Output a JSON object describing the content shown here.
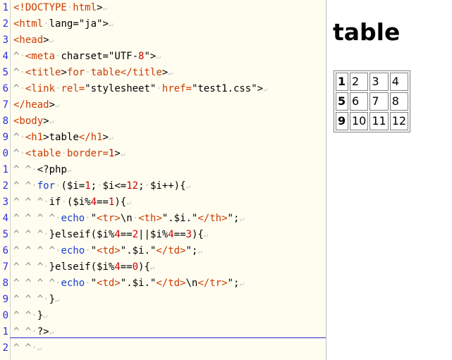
{
  "editor": {
    "line_numbers": [
      "1",
      "2",
      "3",
      "4",
      "5",
      "6",
      "7",
      "8",
      "9",
      "0",
      "1",
      "2",
      "3",
      "4",
      "5",
      "6",
      "7",
      "8",
      "9",
      "0",
      "1",
      "2"
    ],
    "lines": [
      [
        [
          "tag",
          "<!DOCTYPE"
        ],
        [
          "ws",
          "·"
        ],
        [
          "tag",
          "html"
        ],
        [
          "br",
          ">"
        ]
      ],
      [
        [
          "tag",
          "<html"
        ],
        [
          "ws",
          "·"
        ],
        [
          "str",
          "lang=\"ja\""
        ],
        [
          "br",
          ">"
        ]
      ],
      [
        [
          "tag",
          "<head"
        ],
        [
          "br",
          ">"
        ]
      ],
      [
        [
          "indent",
          "^"
        ],
        [
          "ws",
          "·"
        ],
        [
          "tag",
          "<meta"
        ],
        [
          "ws",
          "·"
        ],
        [
          "str",
          "charset=\"UTF-"
        ],
        [
          "num",
          "8"
        ],
        [
          "str",
          "\""
        ],
        [
          "br",
          ">"
        ]
      ],
      [
        [
          "indent",
          "^"
        ],
        [
          "ws",
          "·"
        ],
        [
          "tag",
          "<title"
        ],
        [
          "br",
          ">"
        ],
        [
          "tag",
          "for"
        ],
        [
          "ws",
          "·"
        ],
        [
          "tag",
          "table"
        ],
        [
          "tag",
          "</title"
        ],
        [
          "br",
          ">"
        ]
      ],
      [
        [
          "indent",
          "^"
        ],
        [
          "ws",
          "·"
        ],
        [
          "tag",
          "<link"
        ],
        [
          "ws",
          "·"
        ],
        [
          "tag",
          "rel="
        ],
        [
          "str",
          "\"stylesheet\""
        ],
        [
          "ws",
          "·"
        ],
        [
          "tag",
          "href="
        ],
        [
          "str",
          "\"test1.css\""
        ],
        [
          "br",
          ">"
        ]
      ],
      [
        [
          "tag",
          "</head"
        ],
        [
          "br",
          ">"
        ]
      ],
      [
        [
          "tag",
          "<body"
        ],
        [
          "br",
          ">"
        ]
      ],
      [
        [
          "indent",
          "^"
        ],
        [
          "ws",
          "·"
        ],
        [
          "tag",
          "<h1"
        ],
        [
          "br",
          ">"
        ],
        [
          "op",
          "table"
        ],
        [
          "tag",
          "</h1"
        ],
        [
          "br",
          ">"
        ]
      ],
      [
        [
          "indent",
          "^"
        ],
        [
          "ws",
          "·"
        ],
        [
          "tag",
          "<table"
        ],
        [
          "ws",
          "·"
        ],
        [
          "tag",
          "border="
        ],
        [
          "num",
          "1"
        ],
        [
          "br",
          ">"
        ]
      ],
      [
        [
          "indent",
          "^ ^"
        ],
        [
          "ws",
          "·"
        ],
        [
          "op",
          "<?php"
        ]
      ],
      [
        [
          "indent",
          "^ ^"
        ],
        [
          "ws",
          "·"
        ],
        [
          "kw",
          "for"
        ],
        [
          "ws",
          "·"
        ],
        [
          "op",
          "($i="
        ],
        [
          "num",
          "1"
        ],
        [
          "op",
          ";"
        ],
        [
          "ws",
          "·"
        ],
        [
          "op",
          "$i<="
        ],
        [
          "num",
          "12"
        ],
        [
          "op",
          ";"
        ],
        [
          "ws",
          "·"
        ],
        [
          "op",
          "$i++){"
        ]
      ],
      [
        [
          "indent",
          "^ ^ ^"
        ],
        [
          "ws",
          "·"
        ],
        [
          "op",
          "if"
        ],
        [
          "ws",
          "·"
        ],
        [
          "op",
          "($i%"
        ],
        [
          "num",
          "4"
        ],
        [
          "op",
          "=="
        ],
        [
          "num",
          "1"
        ],
        [
          "op",
          "){"
        ]
      ],
      [
        [
          "indent",
          "^ ^ ^ ^"
        ],
        [
          "ws",
          "·"
        ],
        [
          "kw",
          "echo"
        ],
        [
          "ws",
          "·"
        ],
        [
          "op",
          "\""
        ],
        [
          "tag",
          "<tr>"
        ],
        [
          "op",
          "\\n"
        ],
        [
          "ws",
          "·"
        ],
        [
          "tag",
          "<th>"
        ],
        [
          "op",
          "\".$i.\""
        ],
        [
          "tag",
          "</th>"
        ],
        [
          "op",
          "\";"
        ]
      ],
      [
        [
          "indent",
          "^ ^ ^"
        ],
        [
          "ws",
          "·"
        ],
        [
          "op",
          "}elseif($i%"
        ],
        [
          "num",
          "4"
        ],
        [
          "op",
          "=="
        ],
        [
          "num",
          "2"
        ],
        [
          "op",
          "||$i%"
        ],
        [
          "num",
          "4"
        ],
        [
          "op",
          "=="
        ],
        [
          "num",
          "3"
        ],
        [
          "op",
          "){"
        ]
      ],
      [
        [
          "indent",
          "^ ^ ^ ^"
        ],
        [
          "ws",
          "·"
        ],
        [
          "kw",
          "echo"
        ],
        [
          "ws",
          "·"
        ],
        [
          "op",
          "\""
        ],
        [
          "tag",
          "<td>"
        ],
        [
          "op",
          "\".$i.\""
        ],
        [
          "tag",
          "</td>"
        ],
        [
          "op",
          "\";"
        ]
      ],
      [
        [
          "indent",
          "^ ^ ^"
        ],
        [
          "ws",
          "·"
        ],
        [
          "op",
          "}elseif($i%"
        ],
        [
          "num",
          "4"
        ],
        [
          "op",
          "=="
        ],
        [
          "num",
          "0"
        ],
        [
          "op",
          "){"
        ]
      ],
      [
        [
          "indent",
          "^ ^ ^ ^"
        ],
        [
          "ws",
          "·"
        ],
        [
          "kw",
          "echo"
        ],
        [
          "ws",
          "·"
        ],
        [
          "op",
          "\""
        ],
        [
          "tag",
          "<td>"
        ],
        [
          "op",
          "\".$i.\""
        ],
        [
          "tag",
          "</td>"
        ],
        [
          "op",
          "\\n"
        ],
        [
          "tag",
          "</tr>"
        ],
        [
          "op",
          "\";"
        ]
      ],
      [
        [
          "indent",
          "^ ^ ^"
        ],
        [
          "ws",
          "·"
        ],
        [
          "op",
          "}"
        ]
      ],
      [
        [
          "indent",
          "^ ^"
        ],
        [
          "ws",
          "·"
        ],
        [
          "op",
          "}"
        ]
      ],
      [
        [
          "indent",
          "^ ^"
        ],
        [
          "ws",
          "·"
        ],
        [
          "op",
          "?>"
        ]
      ],
      [
        [
          "indent",
          "^ ^"
        ],
        [
          "ws",
          "·"
        ]
      ]
    ],
    "eol_mark": "↵",
    "colors": {
      "tag": "#cc3b00",
      "keyword": "#1a3fd0",
      "number": "#cc0000",
      "line_number": "#2d2de0",
      "background": "#fefdf0"
    }
  },
  "preview": {
    "heading": "table",
    "table": {
      "rows": [
        {
          "th": "1",
          "td": [
            "2",
            "3",
            "4"
          ]
        },
        {
          "th": "5",
          "td": [
            "6",
            "7",
            "8"
          ]
        },
        {
          "th": "9",
          "td": [
            "10",
            "11",
            "12"
          ]
        }
      ]
    }
  }
}
